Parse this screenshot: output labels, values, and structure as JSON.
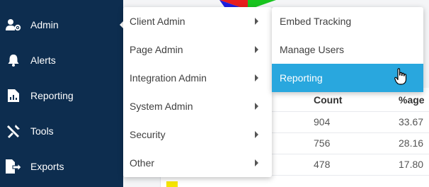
{
  "sidebar": {
    "items": [
      {
        "label": "Admin",
        "icon": "users-gear-icon",
        "active": true
      },
      {
        "label": "Alerts",
        "icon": "bell-icon"
      },
      {
        "label": "Reporting",
        "icon": "report-icon"
      },
      {
        "label": "Tools",
        "icon": "tools-icon"
      },
      {
        "label": "Exports",
        "icon": "export-icon"
      }
    ]
  },
  "menu": {
    "items": [
      {
        "label": "Client Admin"
      },
      {
        "label": "Page Admin"
      },
      {
        "label": "Integration Admin"
      },
      {
        "label": "System Admin"
      },
      {
        "label": "Security"
      },
      {
        "label": "Other"
      }
    ]
  },
  "submenu": {
    "items": [
      {
        "label": "Embed Tracking"
      },
      {
        "label": "Manage Users"
      },
      {
        "label": "Reporting",
        "active": true
      }
    ]
  },
  "table": {
    "headers": {
      "count": "Count",
      "percentage": "%age"
    },
    "rows": [
      {
        "count": "904",
        "percentage": "33.67"
      },
      {
        "count": "756",
        "percentage": "28.16"
      },
      {
        "count": "478",
        "percentage": "17.80"
      }
    ]
  },
  "colors": {
    "sidebar_bg": "#0d2d4f",
    "active_item": "#29a7de",
    "pie_blue": "#1f1fe0",
    "pie_red": "#e81f1f",
    "pie_green": "#19c41f",
    "legend_yellow": "#f5e400"
  }
}
